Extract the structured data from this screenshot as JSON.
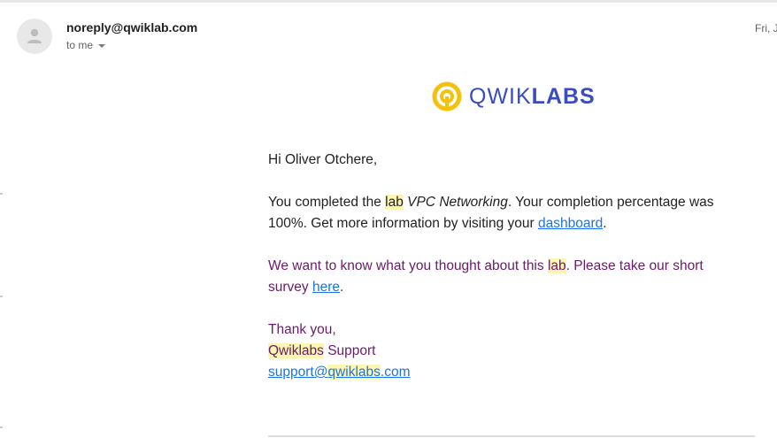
{
  "header": {
    "sender": "noreply@qwiklab.com",
    "recipient": "to me",
    "date": "Fri, J"
  },
  "logo": {
    "text_light": "QWIK",
    "text_bold": "LABS",
    "ring_color": "#F4C20D",
    "text_color": "#3B4CC0"
  },
  "body": {
    "greeting": "Hi Oliver Otchere,",
    "completion": {
      "prefix": "You completed the ",
      "lab_word": "lab",
      "space": " ",
      "lab_name": "VPC Networking",
      "middle": ". Your completion percentage was 100%. Get more information by visiting your ",
      "link_text": "dashboard",
      "suffix": "."
    },
    "survey": {
      "prefix": "We want to know what you thought about this ",
      "lab_word": "lab",
      "middle": ". Please take our short survey ",
      "link_text": "here",
      "suffix": "."
    },
    "signoff": {
      "thanks": "Thank you,",
      "brand": "Qwiklabs",
      "team": " Support",
      "email_prefix": "support@",
      "email_brand": "qwiklabs",
      "email_suffix": ".com"
    }
  }
}
